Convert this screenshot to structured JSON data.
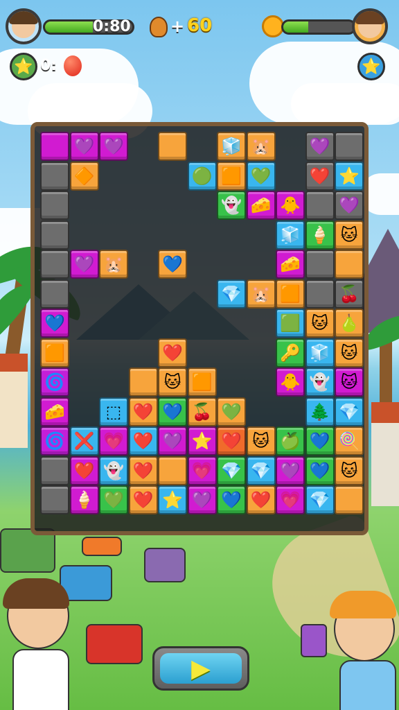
{
  "hud": {
    "timer": "0:80",
    "score_prefix": "+",
    "score": "60",
    "left_counter": "0:",
    "timer_progress": 0.55,
    "enemy_progress": 0.35,
    "colors": {
      "bar_green": "#5bc22b",
      "score_yellow": "#ffd21e"
    }
  },
  "board": {
    "cols": 11,
    "rows": 13,
    "hole_color": "transparent",
    "colors": {
      "M": "#d11bd1",
      "P": "#c41fd8",
      "O": "#f7a43c",
      "B": "#39b6ef",
      "G": "#38c24a",
      "R": "#f06b2b",
      "K": "#6d6d6d",
      "Y": "#f5c23c"
    },
    "grid": [
      [
        "M:",
        "M:💜",
        "M:💜",
        "",
        "O:",
        "",
        "O:🧊",
        "O:🐹",
        "",
        "K:💜",
        "K:"
      ],
      [
        "K:",
        "O:🔶",
        "",
        "",
        "",
        "B:🟢",
        "O:🟧",
        "B:💚",
        "",
        "K:❤️",
        "B:⭐"
      ],
      [
        "K:",
        "",
        "",
        "",
        "",
        "",
        "G:👻",
        "M:🧀",
        "M:🐥",
        "K:",
        "K:💜"
      ],
      [
        "K:",
        "",
        "",
        "",
        "",
        "",
        "",
        "",
        "B:🧊",
        "G:🍦",
        "O:🐱"
      ],
      [
        "K:",
        "M:💜",
        "O:🐹",
        "",
        "O:💙",
        "",
        "",
        "",
        "M:🧀",
        "K:",
        "O:"
      ],
      [
        "K:",
        "",
        "",
        "",
        "",
        "",
        "B:💎",
        "O:🐹",
        "O:🟧",
        "K:",
        "K:🍒"
      ],
      [
        "M:💙",
        "",
        "",
        "",
        "",
        "",
        "",
        "",
        "B:🟩",
        "O:🐱",
        "O:🍐"
      ],
      [
        "O:🟧",
        "",
        "",
        "",
        "O:❤️",
        "",
        "",
        "",
        "G:🔑",
        "B:🧊",
        "O:🐱"
      ],
      [
        "P:🌀",
        "",
        "",
        "O:",
        "O:🐱",
        "O:🟧",
        "",
        "",
        "M:🐥",
        "B:👻",
        "M:🐱"
      ],
      [
        "M:🧀",
        "",
        "B:⬚",
        "O:❤️",
        "G:💙",
        "O:🍒",
        "O:💚",
        "",
        "",
        "B:🌲",
        "B:💎"
      ],
      [
        "P:🌀",
        "B:❌",
        "M:💗",
        "B:❤️",
        "M:💜",
        "M:⭐",
        "R:❤️",
        "O:🐱",
        "G:🍏",
        "G:💙",
        "O:🍭"
      ],
      [
        "K:",
        "M:❤️",
        "B:👻",
        "O:❤️",
        "O:",
        "M:💗",
        "G:💎",
        "B:💎",
        "M:💜",
        "G:💙",
        "O:🐱"
      ],
      [
        "K:",
        "M:🍦",
        "G:💚",
        "O:❤️",
        "B:⭐",
        "M:💜",
        "G:💙",
        "O:❤️",
        "M:💗",
        "B:💎",
        "O:"
      ]
    ]
  },
  "icons": {
    "left_badge": "⭐",
    "left_orb": "●",
    "right_badge": "⭐",
    "score_icon": "🐱",
    "sun_icon": "☀",
    "play_icon": "▶"
  }
}
